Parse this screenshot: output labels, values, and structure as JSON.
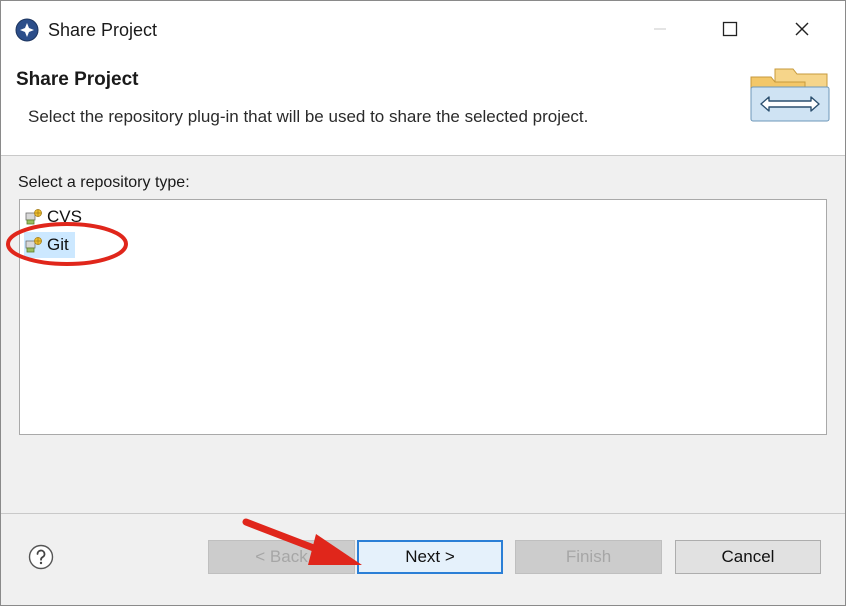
{
  "window": {
    "title": "Share Project",
    "icon": "eclipse-icon"
  },
  "banner": {
    "title": "Share Project",
    "description": "Select the repository plug-in that will be used to share the selected project.",
    "icon": "share-folders-icon"
  },
  "body": {
    "label": "Select a repository type:",
    "repositories": [
      {
        "label": "CVS",
        "selected": false,
        "icon": "repository-icon"
      },
      {
        "label": "Git",
        "selected": true,
        "icon": "repository-icon"
      }
    ]
  },
  "footer": {
    "help_icon": "help-icon",
    "back_label": "< Back",
    "next_label": "Next >",
    "finish_label": "Finish",
    "cancel_label": "Cancel"
  },
  "colors": {
    "selection": "#cce8ff",
    "annotation": "#e0261b",
    "default_button_border": "#2b7fd6"
  }
}
